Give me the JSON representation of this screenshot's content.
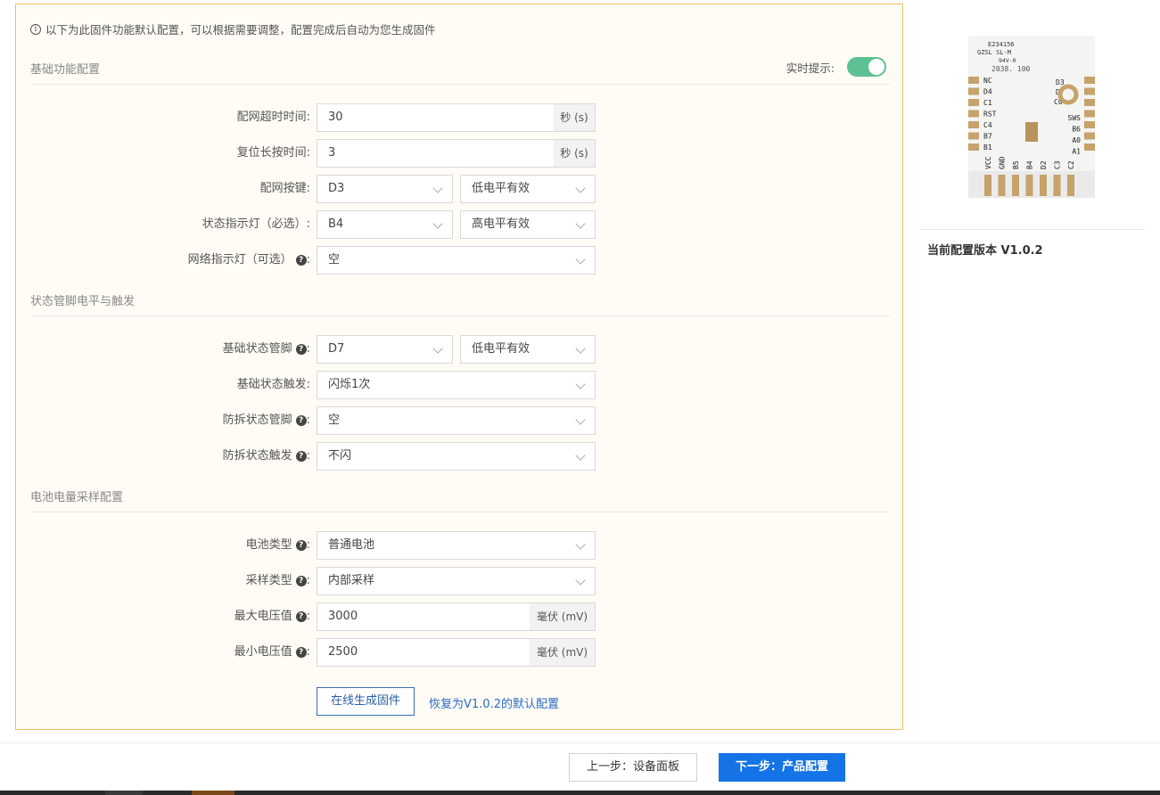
{
  "notice": "以下为此固件功能默认配置，可以根据需要调整，配置完成后自动为您生成固件",
  "realtime_label": "实时提示:",
  "sections": {
    "basic": "基础功能配置",
    "status": "状态管脚电平与触发",
    "battery": "电池电量采样配置"
  },
  "fields": {
    "net_timeout": {
      "label": "配网超时时间:",
      "value": "30",
      "unit": "秒 (s)"
    },
    "reset_press": {
      "label": "复位长按时间:",
      "value": "3",
      "unit": "秒 (s)"
    },
    "net_button": {
      "label": "配网按键:",
      "pin": "D3",
      "level": "低电平有效"
    },
    "status_led": {
      "label": "状态指示灯（必选）:",
      "pin": "B4",
      "level": "高电平有效"
    },
    "net_led": {
      "label": "网络指示灯（可选）",
      "value": "空"
    },
    "base_status_pin": {
      "label": "基础状态管脚",
      "pin": "D7",
      "level": "低电平有效"
    },
    "base_status_trigger": {
      "label": "基础状态触发:",
      "value": "闪烁1次"
    },
    "tamper_pin": {
      "label": "防拆状态管脚",
      "value": "空"
    },
    "tamper_trigger": {
      "label": "防拆状态触发",
      "value": "不闪"
    },
    "battery_type": {
      "label": "电池类型",
      "value": "普通电池"
    },
    "sample_type": {
      "label": "采样类型",
      "value": "内部采样"
    },
    "max_voltage": {
      "label": "最大电压值",
      "value": "3000",
      "unit": "毫伏 (mV)"
    },
    "min_voltage": {
      "label": "最小电压值",
      "value": "2500",
      "unit": "毫伏 (mV)"
    }
  },
  "colon": ":",
  "actions": {
    "generate": "在线生成固件",
    "reset": "恢复为V1.0.2的默认配置"
  },
  "version_text": "当前配置版本 V1.0.2",
  "chip": {
    "line1": "E234156",
    "line2": "GZSL SL-M",
    "line3": "94V-0",
    "line4": "2038. 100",
    "left_pins": [
      "NC",
      "D4",
      "C1",
      "RST",
      "C4",
      "B7",
      "B1"
    ],
    "right_pins": [
      "SWS",
      "B6",
      "A0",
      "A1"
    ],
    "right_top": [
      "D3",
      "D7",
      "C0"
    ],
    "bottom_pins": [
      "VCC",
      "GND",
      "B5",
      "B4",
      "D2",
      "C3",
      "C2"
    ]
  },
  "footer": {
    "prev": "上一步：设备面板",
    "next": "下一步：产品配置"
  },
  "colors": {
    "accent": "#1473e6",
    "toggle": "#5cc193",
    "panel_border": "#f0c060"
  }
}
